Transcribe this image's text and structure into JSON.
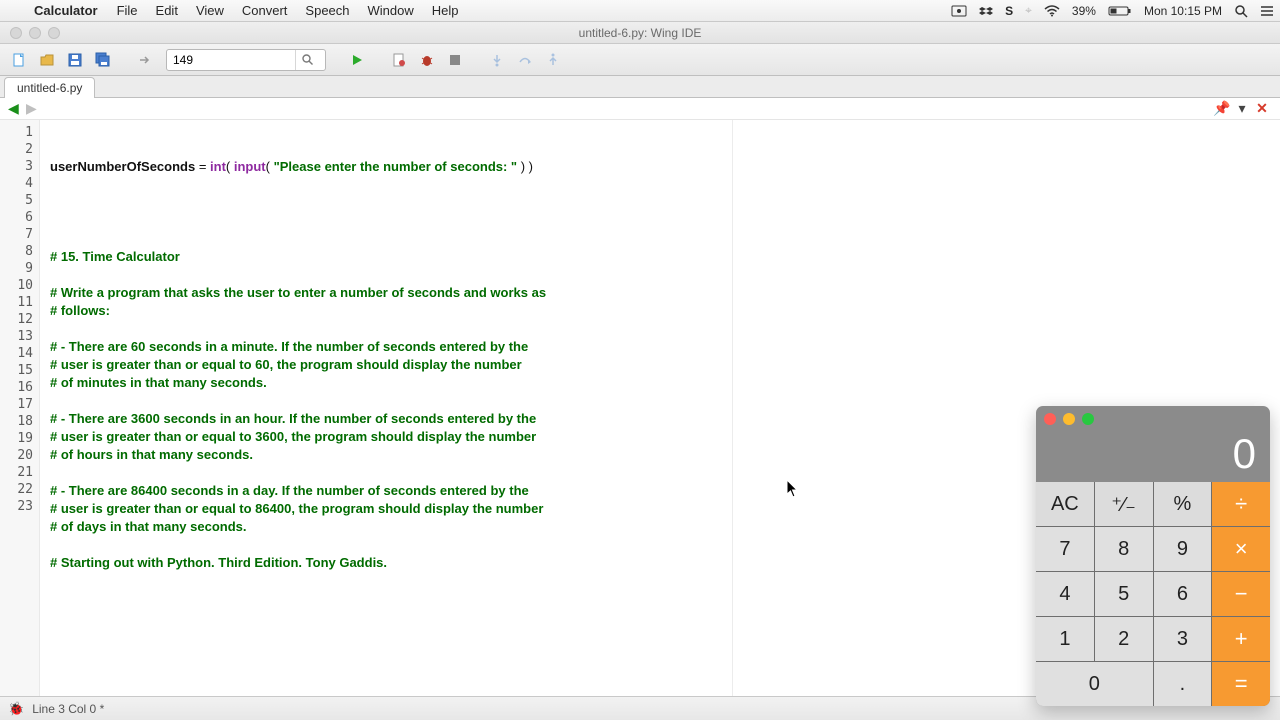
{
  "menubar": {
    "app": "Calculator",
    "items": [
      "File",
      "Edit",
      "View",
      "Convert",
      "Speech",
      "Window",
      "Help"
    ],
    "battery": "39%",
    "clock": "Mon 10:15 PM"
  },
  "window": {
    "title": "untitled-6.py: Wing IDE"
  },
  "toolbar": {
    "search_value": "149"
  },
  "tabs": {
    "active": "untitled-6.py"
  },
  "nav_icons": {
    "pin": "📌",
    "chevron": "▾",
    "close": "✕"
  },
  "editor": {
    "line_count": 23,
    "code": {
      "l1_id": "userNumberOfSeconds",
      "l1_eq": " = ",
      "l1_int": "int",
      "l1_p1": "( ",
      "l1_input": "input",
      "l1_p2": "( ",
      "l1_str": "\"Please enter the number of seconds: \"",
      "l1_p3": " ) )",
      "l6": "# 15. Time Calculator",
      "l8": "# Write a program that asks the user to enter a number of seconds and works as",
      "l9": "# follows:",
      "l11": "# - There are 60 seconds in a minute. If the number of seconds entered by the",
      "l12": "# user is greater than or equal to 60, the program should display the number",
      "l13": "# of minutes in that many seconds.",
      "l15": "# - There are 3600 seconds in an hour. If the number of seconds entered by the",
      "l16": "# user is greater than or equal to 3600, the program should display the number",
      "l17": "# of hours in that many seconds.",
      "l19": "# - There are 86400 seconds in a day. If the number of seconds entered by the",
      "l20": "# user is greater than or equal to 86400, the program should display the number",
      "l21": "# of days in that many seconds.",
      "l23": "# Starting out with Python. Third Edition. Tony Gaddis."
    }
  },
  "status": {
    "text": "Line 3 Col 0 *"
  },
  "calc": {
    "display": "0",
    "keys": {
      "ac": "AC",
      "pm": "⁺⁄₋",
      "pct": "%",
      "div": "÷",
      "k7": "7",
      "k8": "8",
      "k9": "9",
      "mul": "×",
      "k4": "4",
      "k5": "5",
      "k6": "6",
      "sub": "−",
      "k1": "1",
      "k2": "2",
      "k3": "3",
      "add": "+",
      "k0": "0",
      "dot": ".",
      "eq": "="
    }
  }
}
